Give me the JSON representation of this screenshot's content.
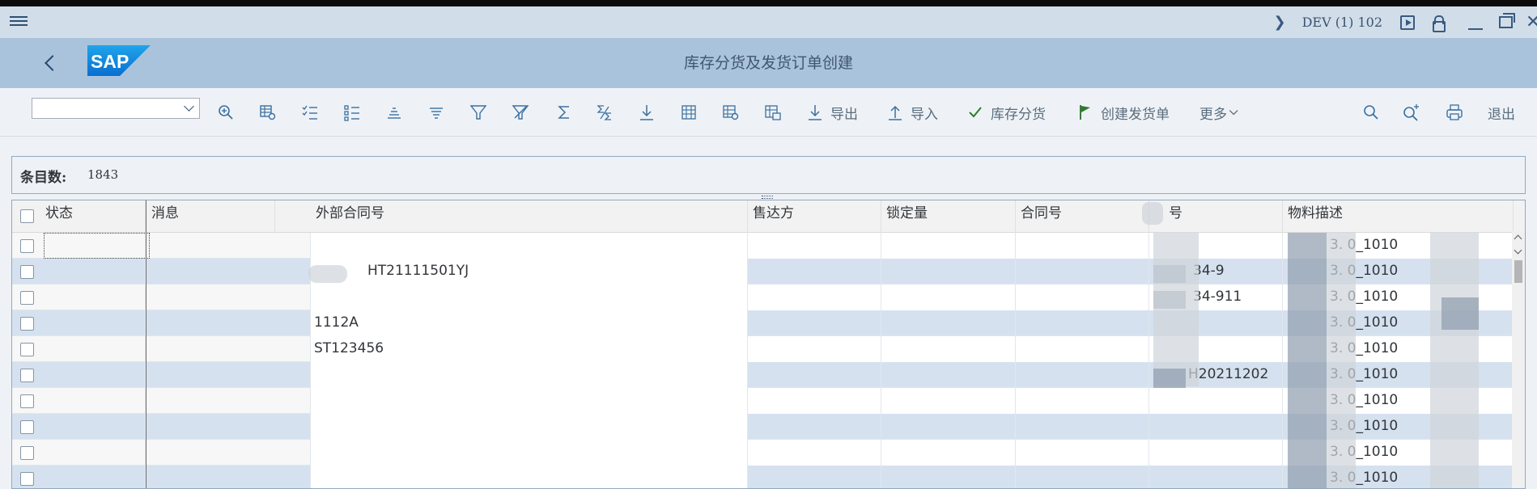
{
  "system": {
    "id": "DEV (1) 102"
  },
  "header": {
    "title": "库存分货及发货订单创建",
    "logo_text": "SAP"
  },
  "toolbar": {
    "select_value": "",
    "export_label": "导出",
    "import_label": "导入",
    "allocate_label": "库存分货",
    "create_delivery_label": "创建发货单",
    "more_label": "更多",
    "exit_label": "退出"
  },
  "count": {
    "label": "条目数:",
    "value": "1843"
  },
  "table": {
    "headers": {
      "status": "状态",
      "message": "消息",
      "ext_contract": "外部合同号",
      "sold_to": "售达方",
      "locked_qty": "锁定量",
      "contract_no": "合同号",
      "material_no": "号",
      "material_desc": "物料描述"
    },
    "rows": [
      {
        "ext_contract": "",
        "material_no": "",
        "material_desc": "3. 0_1010"
      },
      {
        "ext_contract": "HT21111501YJ",
        "material_no": "34-9",
        "material_desc": "3. 0_1010"
      },
      {
        "ext_contract": "",
        "material_no": "34-911",
        "material_desc": "3. 0_1010"
      },
      {
        "ext_contract": "1112A",
        "material_no": "",
        "material_desc": "3. 0_1010"
      },
      {
        "ext_contract": "ST123456",
        "material_no": "",
        "material_desc": "3. 0_1010"
      },
      {
        "ext_contract": "",
        "material_no": "H20211202",
        "material_desc": "3. 0_1010"
      },
      {
        "ext_contract": "",
        "material_no": "",
        "material_desc": "3. 0_1010"
      },
      {
        "ext_contract": "",
        "material_no": "",
        "material_desc": "3. 0_1010"
      },
      {
        "ext_contract": "",
        "material_no": "",
        "material_desc": "3. 0_1010"
      },
      {
        "ext_contract": "",
        "material_no": "",
        "material_desc": "3. 0_1010"
      }
    ]
  },
  "colors": {
    "header_bg": "#a9c3dc",
    "sysbar_bg": "#d1dee9",
    "row_alt": "#d5e1ef",
    "accent_green": "#2b7d2b",
    "icon_blue": "#3a6f9f"
  }
}
